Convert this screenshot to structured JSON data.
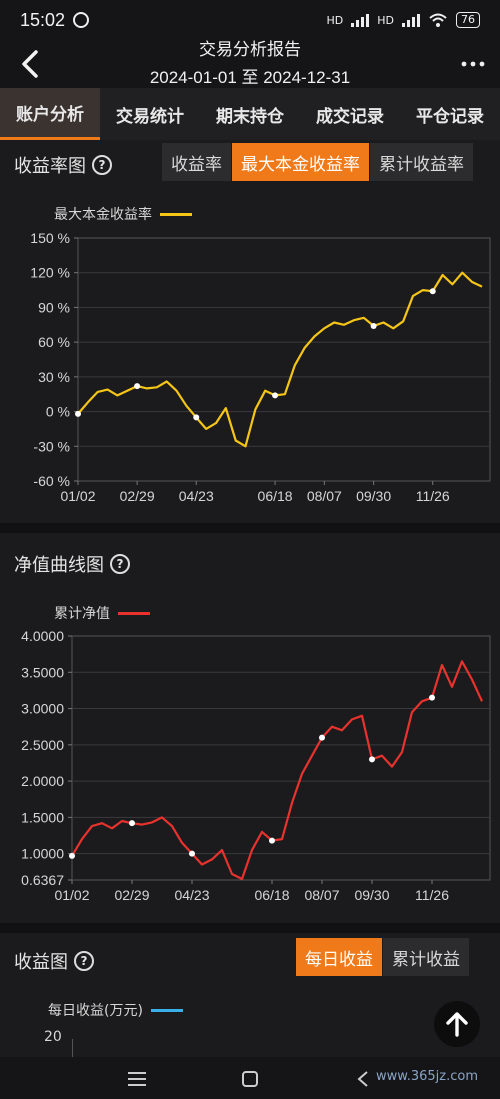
{
  "status_bar": {
    "time": "15:02",
    "battery": "76",
    "signal_label_1": "HD",
    "signal_label_2": "HD"
  },
  "header": {
    "title": "交易分析报告",
    "date_range": "2024-01-01 至 2024-12-31"
  },
  "tabs": [
    {
      "label": "账户分析",
      "active": true
    },
    {
      "label": "交易统计",
      "active": false
    },
    {
      "label": "期末持仓",
      "active": false
    },
    {
      "label": "成交记录",
      "active": false
    },
    {
      "label": "平仓记录",
      "active": false
    }
  ],
  "return_chart": {
    "heading": "收益率图",
    "segments": [
      {
        "label": "收益率",
        "active": false
      },
      {
        "label": "最大本金收益率",
        "active": true
      },
      {
        "label": "累计收益率",
        "active": false
      }
    ],
    "legend": "最大本金收益率",
    "color": "#f5c518"
  },
  "nav_chart": {
    "heading": "净值曲线图",
    "legend": "累计净值",
    "color": "#e8322e"
  },
  "profit_chart": {
    "heading": "收益图",
    "segments": [
      {
        "label": "每日收益",
        "active": true
      },
      {
        "label": "累计收益",
        "active": false
      }
    ],
    "legend": "每日收益(万元)",
    "color": "#3ab0e8",
    "y_top_label": "20"
  },
  "watermark": "www.365jz.com",
  "chart_data": [
    {
      "type": "line",
      "title": "",
      "series": [
        {
          "name": "最大本金收益率"
        }
      ],
      "x_tick_labels": [
        "01/02",
        "02/29",
        "04/23",
        "06/18",
        "08/07",
        "09/30",
        "11/26"
      ],
      "y_tick_labels": [
        "150 %",
        "120 %",
        "90 %",
        "60 %",
        "30 %",
        "0 %",
        "-30 %",
        "-60 %"
      ],
      "ylim": [
        -60,
        150
      ],
      "x": [
        "01/02",
        "01/10",
        "01/18",
        "01/26",
        "02/05",
        "02/15",
        "02/29",
        "03/10",
        "03/20",
        "03/30",
        "04/08",
        "04/15",
        "04/23",
        "05/01",
        "05/08",
        "05/15",
        "05/22",
        "05/29",
        "06/05",
        "06/12",
        "06/18",
        "06/26",
        "07/05",
        "07/15",
        "07/25",
        "08/07",
        "08/17",
        "08/27",
        "09/06",
        "09/16",
        "09/30",
        "10/10",
        "10/20",
        "10/30",
        "11/08",
        "11/16",
        "11/26",
        "12/03",
        "12/10",
        "12/17",
        "12/24",
        "12/31"
      ],
      "values": [
        -2,
        8,
        17,
        19,
        14,
        18,
        22,
        20,
        21,
        26,
        18,
        5,
        -5,
        -15,
        -10,
        3,
        -25,
        -30,
        2,
        18,
        14,
        15,
        40,
        55,
        65,
        72,
        77,
        75,
        79,
        81,
        74,
        77,
        72,
        78,
        100,
        105,
        104,
        118,
        110,
        120,
        112,
        108
      ],
      "markers_at": [
        "01/02",
        "02/29",
        "04/23",
        "06/18",
        "09/30",
        "11/26"
      ]
    },
    {
      "type": "line",
      "title": "",
      "series": [
        {
          "name": "累计净值"
        }
      ],
      "x_tick_labels": [
        "01/02",
        "02/29",
        "04/23",
        "06/18",
        "08/07",
        "09/30",
        "11/26"
      ],
      "y_tick_labels": [
        "4.0000",
        "3.5000",
        "3.0000",
        "2.5000",
        "2.0000",
        "1.5000",
        "1.0000",
        "0.6367"
      ],
      "y_tick_values": [
        4.0,
        3.5,
        3.0,
        2.5,
        2.0,
        1.5,
        1.0,
        0.6367
      ],
      "ylim": [
        0.6367,
        4.0
      ],
      "x": [
        "01/02",
        "01/10",
        "01/18",
        "01/26",
        "02/05",
        "02/15",
        "02/29",
        "03/10",
        "03/20",
        "03/30",
        "04/08",
        "04/15",
        "04/23",
        "05/01",
        "05/08",
        "05/15",
        "05/22",
        "05/29",
        "06/05",
        "06/12",
        "06/18",
        "06/26",
        "07/05",
        "07/15",
        "07/25",
        "08/07",
        "08/17",
        "08/27",
        "09/06",
        "09/16",
        "09/30",
        "10/10",
        "10/20",
        "10/30",
        "11/08",
        "11/16",
        "11/26",
        "12/03",
        "12/10",
        "12/17",
        "12/24",
        "12/31"
      ],
      "values": [
        0.97,
        1.2,
        1.38,
        1.42,
        1.35,
        1.45,
        1.42,
        1.4,
        1.43,
        1.5,
        1.38,
        1.15,
        1.0,
        0.85,
        0.92,
        1.05,
        0.72,
        0.65,
        1.05,
        1.3,
        1.18,
        1.2,
        1.7,
        2.1,
        2.35,
        2.6,
        2.75,
        2.7,
        2.85,
        2.9,
        2.3,
        2.35,
        2.2,
        2.4,
        2.95,
        3.1,
        3.15,
        3.6,
        3.3,
        3.65,
        3.4,
        3.1
      ],
      "markers_at": [
        "01/02",
        "02/29",
        "04/23",
        "06/18",
        "08/07",
        "09/30",
        "11/26"
      ]
    },
    {
      "type": "bar",
      "title": "",
      "series": [
        {
          "name": "每日收益(万元)"
        }
      ],
      "y_tick_labels": [
        "20"
      ]
    }
  ]
}
